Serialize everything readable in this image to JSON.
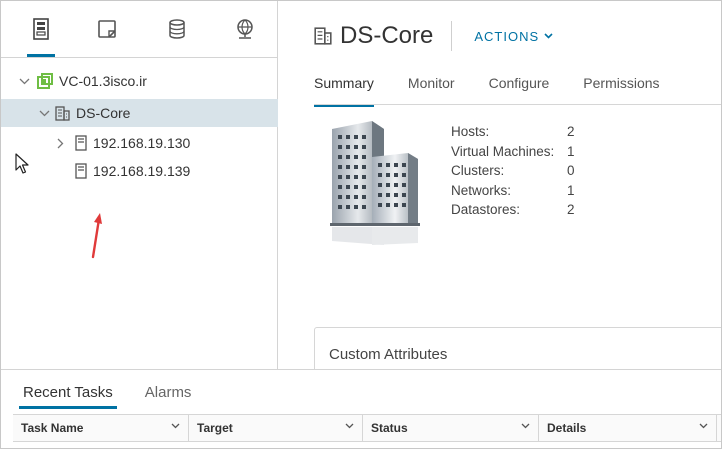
{
  "nav": {
    "tabs": [
      {
        "name": "hosts-clusters-icon"
      },
      {
        "name": "vms-templates-icon"
      },
      {
        "name": "storage-icon"
      },
      {
        "name": "networking-icon"
      }
    ],
    "tree": [
      {
        "label": "VC-01.3isco.ir",
        "type": "vcenter",
        "expanded": true
      },
      {
        "label": "DS-Core",
        "type": "datacenter",
        "expanded": true,
        "selected": true
      },
      {
        "label": "192.168.19.130",
        "type": "host",
        "expanded": false
      },
      {
        "label": "192.168.19.139",
        "type": "host"
      }
    ]
  },
  "main": {
    "title": "DS-Core",
    "actions_label": "ACTIONS",
    "tabs": [
      "Summary",
      "Monitor",
      "Configure",
      "Permissions"
    ],
    "stats": [
      {
        "label": "Hosts:",
        "value": "2"
      },
      {
        "label": "Virtual Machines:",
        "value": "1"
      },
      {
        "label": "Clusters:",
        "value": "0"
      },
      {
        "label": "Networks:",
        "value": "1"
      },
      {
        "label": "Datastores:",
        "value": "2"
      }
    ],
    "custom_attributes_title": "Custom Attributes"
  },
  "bottom": {
    "tabs": [
      "Recent Tasks",
      "Alarms"
    ],
    "columns": [
      "Task Name",
      "Target",
      "Status",
      "Details"
    ]
  },
  "colors": {
    "accent": "#0072a3",
    "selected_row": "#d8e3e9",
    "vcenter_icon": "#6fbe44",
    "annotation_arrow": "#e03a3a"
  }
}
